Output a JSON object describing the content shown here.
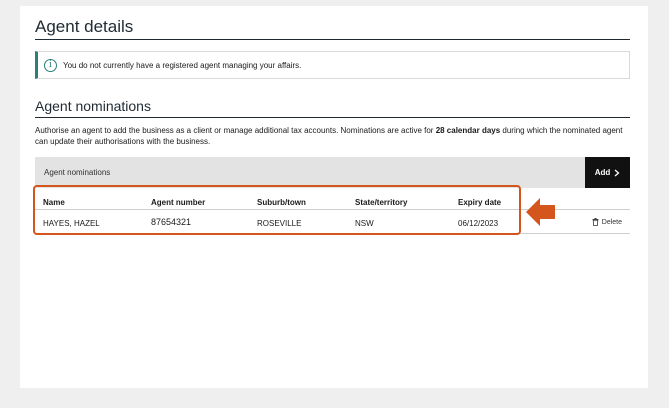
{
  "page": {
    "title": "Agent details",
    "notice": "You do not currently have a registered agent managing your affairs.",
    "section_title": "Agent nominations",
    "description_before": "Authorise an agent to add the business as a client or manage additional tax accounts. Nominations are active for ",
    "description_bold": "28 calendar days",
    "description_after": " during which the nominated agent can update their authorisations with the business."
  },
  "nominations": {
    "bar_title": "Agent nominations",
    "add_label": "Add",
    "add_icon": "chevron-right-icon",
    "columns": [
      "Name",
      "Agent number",
      "Suburb/town",
      "State/territory",
      "Expiry date"
    ],
    "rows": [
      {
        "name": "HAYES, HAZEL",
        "agent_number": "87654321",
        "suburb": "ROSEVILLE",
        "state": "NSW",
        "expiry": "06/12/2023",
        "delete_label": "Delete",
        "delete_icon": "trash-icon"
      }
    ]
  },
  "colors": {
    "highlight": "#d4561c",
    "accent": "#2a7f78",
    "button_bg": "#111111",
    "bar_bg": "#e3e3e3"
  }
}
